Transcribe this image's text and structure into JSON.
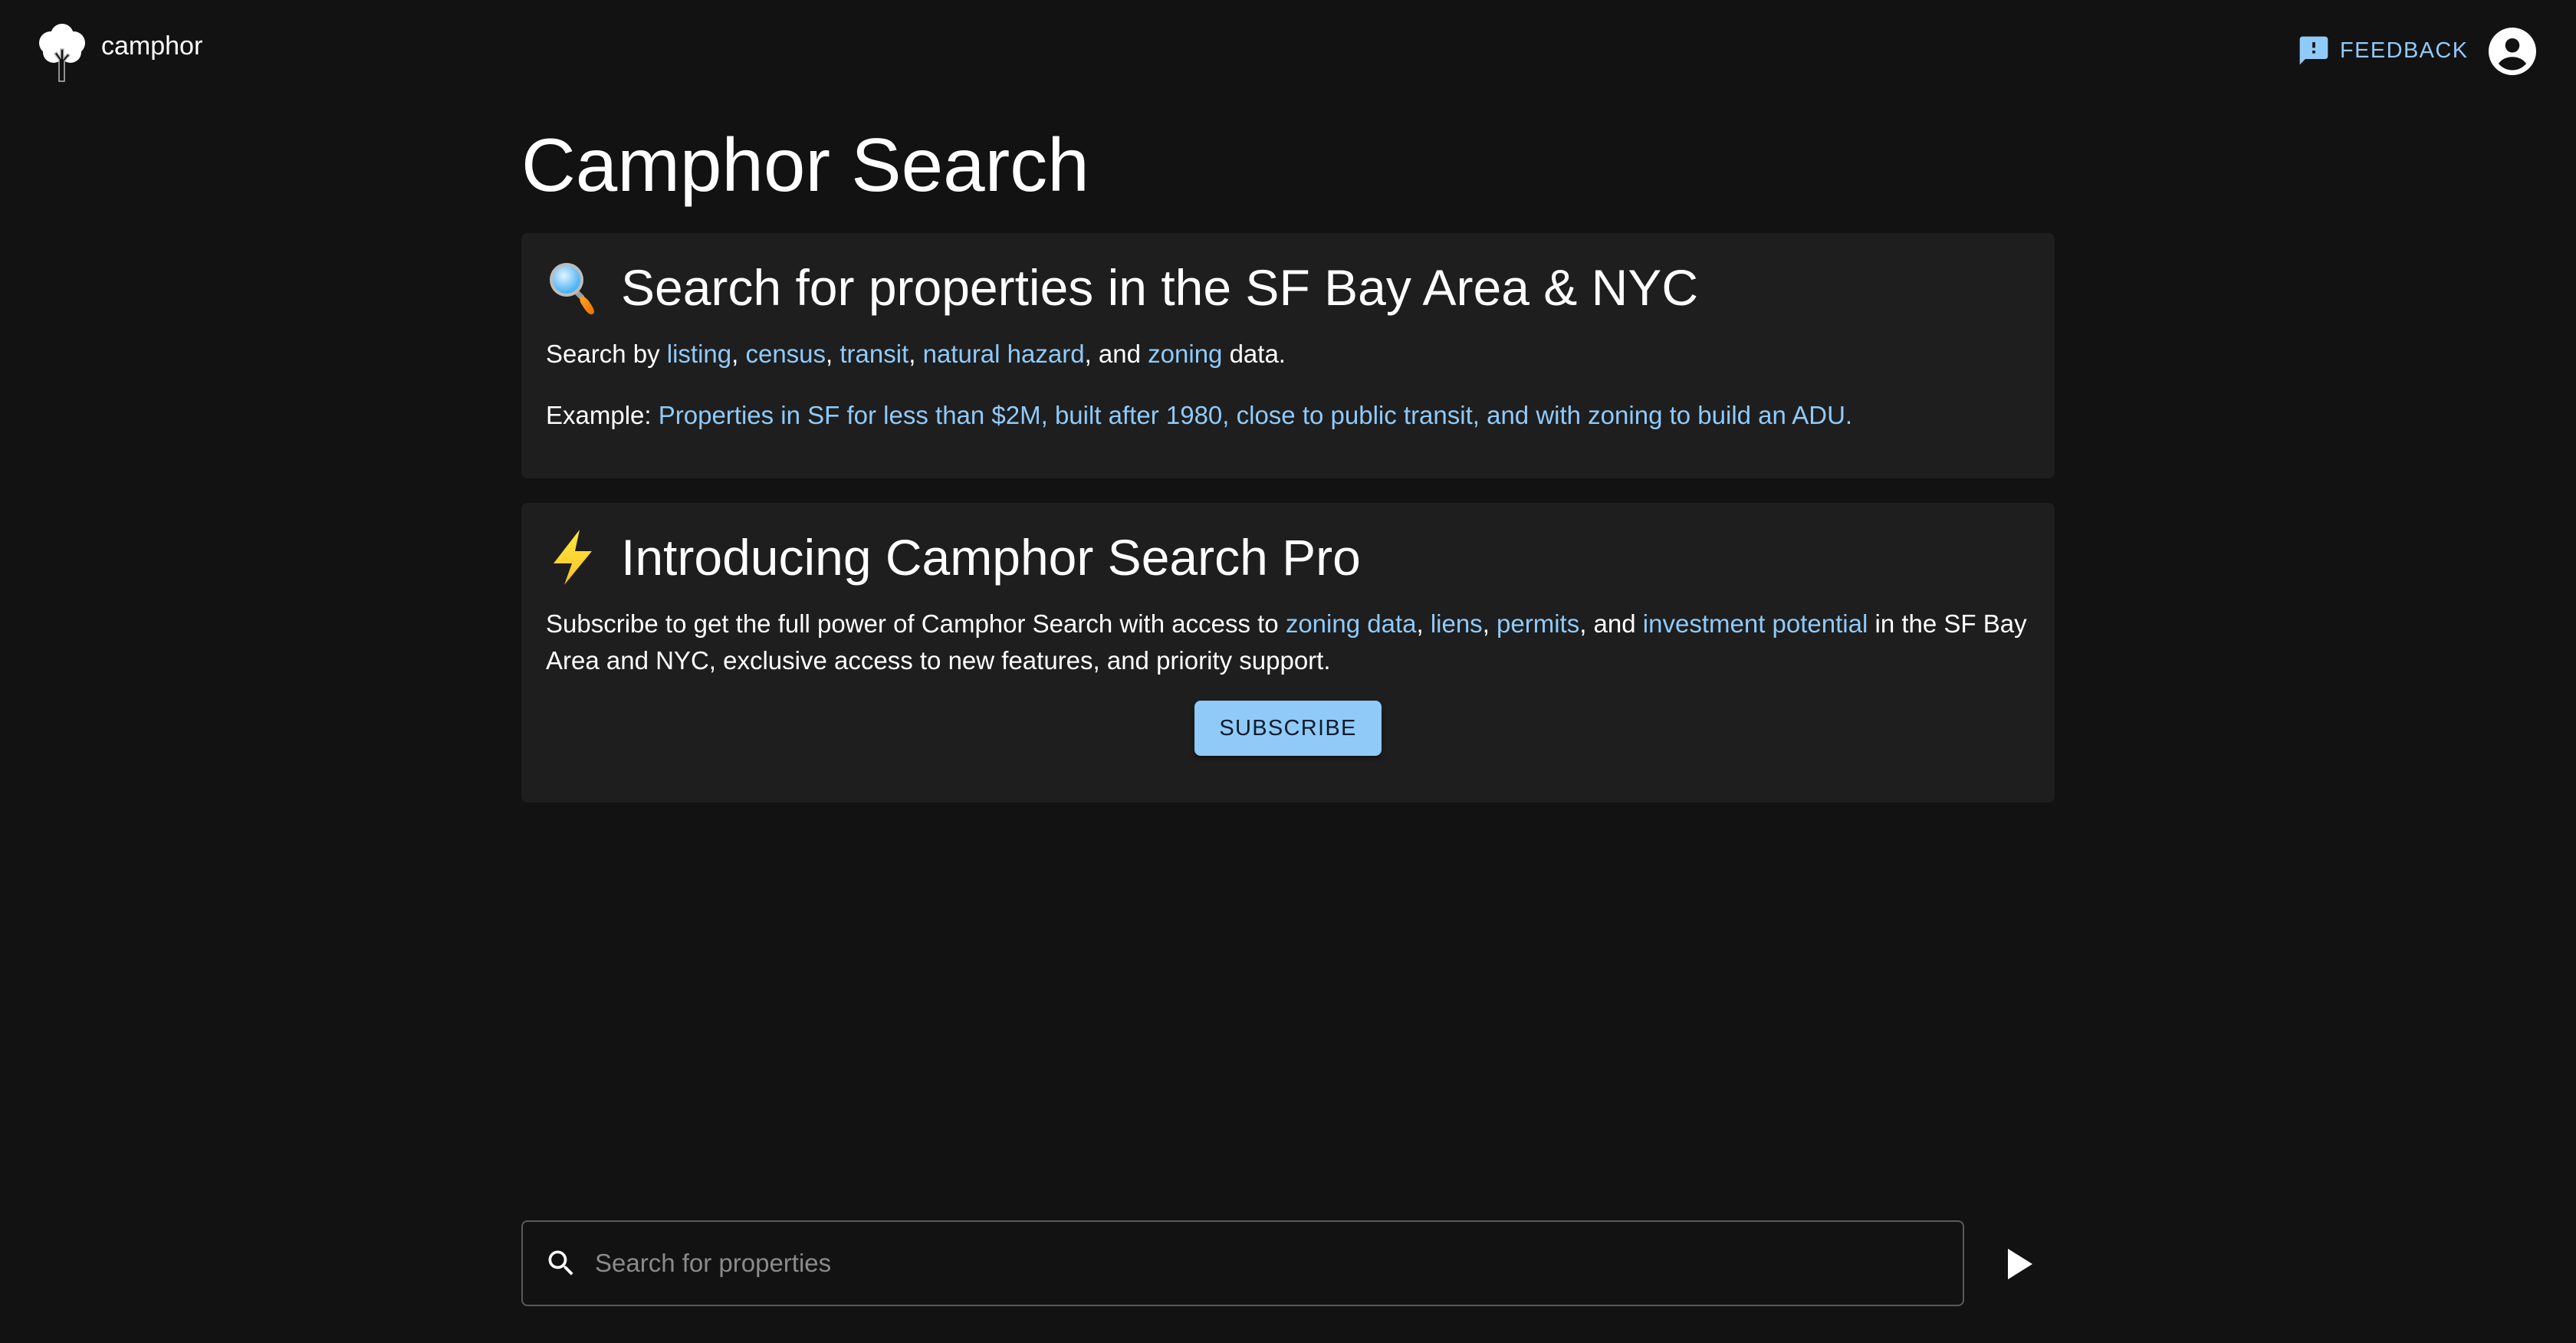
{
  "header": {
    "brand_name": "camphor",
    "feedback_label": "FEEDBACK",
    "feedback_icon": "feedback-icon",
    "account_icon": "account-circle-icon"
  },
  "main": {
    "title": "Camphor Search",
    "card1": {
      "emoji": "magnifying-glass",
      "heading": "Search for properties in the SF Bay Area & NYC",
      "line1": {
        "prefix": "Search by ",
        "links": [
          "listing",
          "census",
          "transit",
          "natural hazard",
          "zoning"
        ],
        "sep1": ", ",
        "sep2": ", ",
        "sep3": ", ",
        "sep4": ", and ",
        "suffix": " data."
      },
      "line2": {
        "prefix": "Example: ",
        "example_link": "Properties in SF for less than $2M, built after 1980, close to public transit, and with zoning to build an ADU."
      }
    },
    "card2": {
      "emoji": "high-voltage",
      "heading": "Introducing Camphor Search Pro",
      "text_before": "Subscribe to get the full power of Camphor Search with access to ",
      "links": [
        "zoning data",
        "liens",
        "permits",
        "investment potential"
      ],
      "sep1": ", ",
      "sep2": ", ",
      "sep3": ", and ",
      "text_after": " in the SF Bay Area and NYC, exclusive access to new features, and priority support.",
      "button_label": "SUBSCRIBE"
    }
  },
  "search": {
    "placeholder": "Search for properties",
    "value": ""
  },
  "colors": {
    "background": "#121212",
    "card": "#1e1e1e",
    "accent": "#90caf9"
  }
}
